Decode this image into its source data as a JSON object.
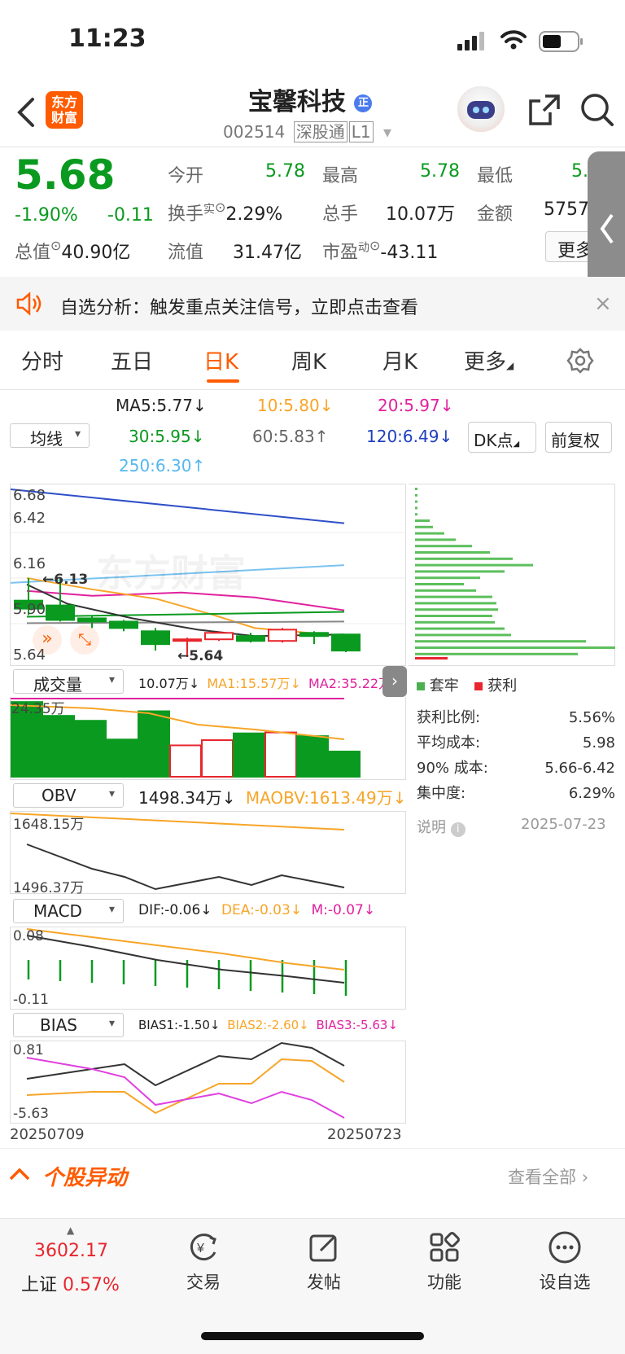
{
  "status": {
    "time": "11:23"
  },
  "header": {
    "title": "宝馨科技",
    "title_badge": "正",
    "code": "002514",
    "market": "深股通",
    "level": "L1",
    "logo_line1": "东方",
    "logo_line2": "财富"
  },
  "quote": {
    "price": "5.68",
    "pct": "-1.90%",
    "chg": "-0.11",
    "open_l": "今开",
    "open": "5.78",
    "high_l": "最高",
    "high": "5.78",
    "low_l": "最低",
    "low": "5.",
    "turn_l": "换手",
    "turn_sup": "实",
    "turn": "2.29%",
    "vol_l": "总手",
    "vol": "10.07万",
    "amt_l": "金额",
    "amt": "5757",
    "mcap_l": "总值",
    "mcap": "40.90亿",
    "flt_l": "流值",
    "flt": "31.47亿",
    "pe_l": "市盈",
    "pe_sup": "动",
    "pe": "-43.11",
    "more": "更多"
  },
  "banner": {
    "label": "自选分析：",
    "text": "触发重点关注信号，立即点击查看",
    "close": "×"
  },
  "tabs": [
    "分时",
    "五日",
    "日K",
    "周K",
    "月K",
    "更多"
  ],
  "ma": {
    "select": "均线",
    "ma5": "MA5:5.77",
    "ma10": "10:5.80",
    "ma20": "20:5.97",
    "ma30": "30:5.95",
    "ma60": "60:5.83",
    "ma120": "120:6.49",
    "ma250": "250:6.30",
    "arrow_down": "↓",
    "arrow_up": "↑",
    "dk": "DK点",
    "fq": "前复权"
  },
  "kline": {
    "y_labels": [
      "6.68",
      "6.42",
      "6.16",
      "5.90",
      "5.64"
    ],
    "hi_mark": "6.13",
    "lo_mark": "5.64",
    "watermark": "东方财富",
    "candles": [
      {
        "o": 5.99,
        "c": 5.94,
        "h": 6.13,
        "l": 5.9,
        "up": false
      },
      {
        "o": 5.96,
        "c": 5.87,
        "h": 6.13,
        "l": 5.86,
        "up": false
      },
      {
        "o": 5.88,
        "c": 5.86,
        "h": 5.9,
        "l": 5.82,
        "up": false
      },
      {
        "o": 5.86,
        "c": 5.82,
        "h": 5.87,
        "l": 5.8,
        "up": false
      },
      {
        "o": 5.8,
        "c": 5.72,
        "h": 5.82,
        "l": 5.68,
        "up": false
      },
      {
        "o": 5.74,
        "c": 5.75,
        "h": 5.76,
        "l": 5.64,
        "up": true
      },
      {
        "o": 5.75,
        "c": 5.79,
        "h": 5.8,
        "l": 5.74,
        "up": true
      },
      {
        "o": 5.77,
        "c": 5.74,
        "h": 5.79,
        "l": 5.73,
        "up": false
      },
      {
        "o": 5.74,
        "c": 5.81,
        "h": 5.82,
        "l": 5.73,
        "up": true
      },
      {
        "o": 5.79,
        "c": 5.77,
        "h": 5.8,
        "l": 5.72,
        "up": false
      },
      {
        "o": 5.78,
        "c": 5.68,
        "h": 5.78,
        "l": 5.67,
        "up": false
      }
    ]
  },
  "volume": {
    "select": "成交量",
    "v": "10.07万",
    "ma1": "MA1:15.57万",
    "ma2": "MA2:35.22万",
    "y_label": "24.35万",
    "bars": [
      {
        "v": 24.3,
        "up": false
      },
      {
        "v": 19.8,
        "up": false
      },
      {
        "v": 18.2,
        "up": false
      },
      {
        "v": 12.1,
        "up": false
      },
      {
        "v": 21.3,
        "up": false
      },
      {
        "v": 10.2,
        "up": true
      },
      {
        "v": 11.9,
        "up": true
      },
      {
        "v": 14.1,
        "up": false
      },
      {
        "v": 14.4,
        "up": true
      },
      {
        "v": 13.2,
        "up": false
      },
      {
        "v": 8.2,
        "up": false
      }
    ]
  },
  "obv": {
    "select": "OBV",
    "v": "1498.34万",
    "ma": "MAOBV:1613.49万",
    "y_top": "1648.15万",
    "y_bot": "1496.37万"
  },
  "macd": {
    "select": "MACD",
    "dif": "DIF:-0.06",
    "dea": "DEA:-0.03",
    "m": "M:-0.07",
    "y_top": "0.08",
    "y_bot": "-0.11"
  },
  "bias": {
    "select": "BIAS",
    "b1": "BIAS1:-1.50",
    "b2": "BIAS2:-2.60",
    "b3": "BIAS3:-5.63",
    "y_top": "0.81",
    "y_bot": "-5.63"
  },
  "dates": {
    "start": "20250709",
    "end": "20250723"
  },
  "chips": {
    "legend_trap": "套牢",
    "legend_profit": "获利",
    "rows": [
      {
        "k": "获利比例:",
        "v": "5.56%"
      },
      {
        "k": "平均成本:",
        "v": "5.98"
      },
      {
        "k": "90% 成本:",
        "v": "5.66-6.42"
      },
      {
        "k": "集中度:",
        "v": "6.29%"
      }
    ],
    "note": "说明",
    "date": "2025-07-23"
  },
  "movers": {
    "title": "个股异动",
    "all": "查看全部"
  },
  "bottom": {
    "index_val": "3602.17",
    "index_name": "上证",
    "index_pct": "0.57%",
    "trade": "交易",
    "post": "发帖",
    "func": "功能",
    "fav": "设自选"
  },
  "colors": {
    "up": "#e8262d",
    "down": "#0a9a1f",
    "accent": "#ff5b00"
  }
}
